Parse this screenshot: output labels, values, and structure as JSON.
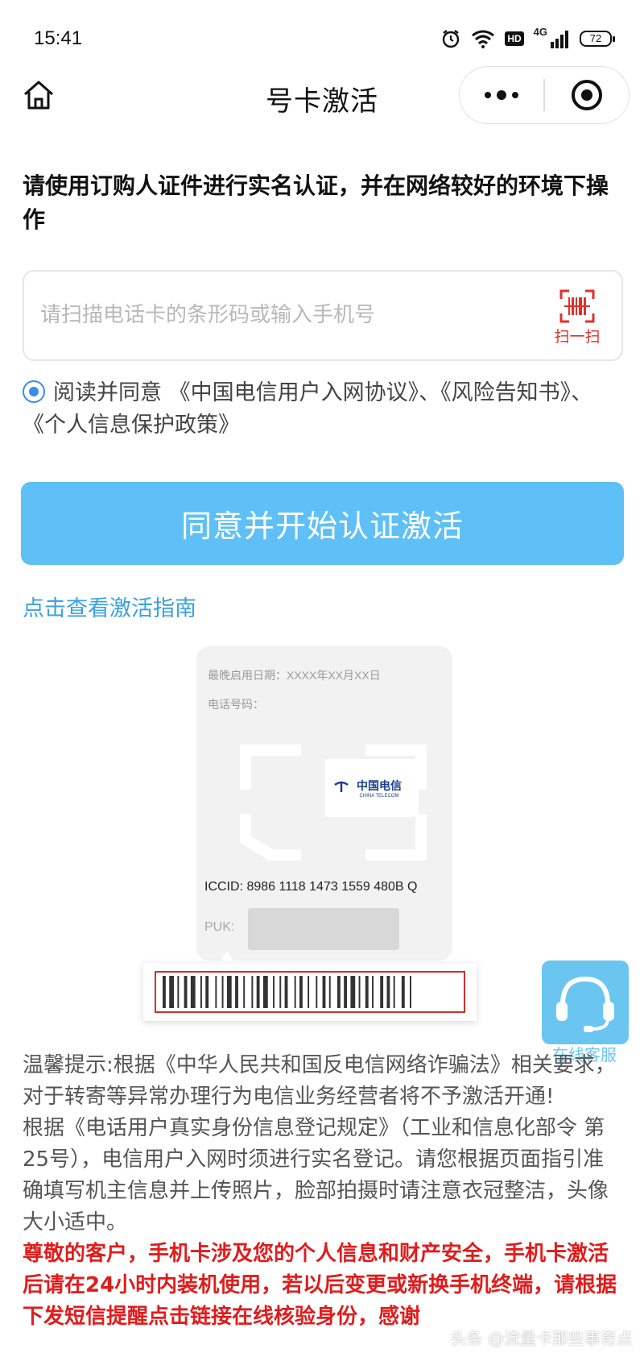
{
  "status_bar": {
    "time": "15:41",
    "network": "4G",
    "hd": "HD",
    "battery": "72"
  },
  "nav": {
    "title": "号卡激活"
  },
  "intro": {
    "text": "请使用订购人证件进行实名认证，并在网络较好的环境下操作"
  },
  "search": {
    "placeholder": "请扫描电话卡的条形码或输入手机号",
    "value": "",
    "scan_label": "扫一扫"
  },
  "agreement": {
    "text": "阅读并同意 《中国电信用户入网协议》、《风险告知书》、《个人信息保护政策》",
    "checked": true
  },
  "primary_button": {
    "label": "同意并开始认证激活"
  },
  "guide_link": {
    "label": "点击查看激活指南"
  },
  "card_illustration": {
    "deadline_line": "最晚启用日期：XXXX年XX月XX日",
    "phone_line": "电话号码：",
    "logo_text": "中国电信",
    "logo_sub": "CHINA TELECOM",
    "iccid": "ICCID:  8986 1118 1473 1559 480B Q",
    "puk_label": "PUK:"
  },
  "customer_service": {
    "label": "在线客服"
  },
  "tips": {
    "p1": "温馨提示:根据《中华人民共和国反电信网络诈骗法》相关要求，对于转寄等异常办理行为电信业务经营者将不予激活开通!",
    "p2": "根据《电话用户真实身份信息登记规定》（工业和信息化部令 第25号），电信用户入网时须进行实名登记。请您根据页面指引准确填写机主信息并上传照片，脸部拍摄时请注意衣冠整洁，头像大小适中。",
    "p3": "尊敬的客户，手机卡涉及您的个人信息和财产安全，手机卡激活后请在24小时内装机使用，若以后变更或新换手机终端，请根据下发短信提醒点击链接在线核验身份，感谢"
  },
  "watermark": "头条 @流量卡那些事奇点",
  "colors": {
    "primary_button": "#5ec0f6",
    "link": "#3aa1e0",
    "warning_red": "#e01c1c",
    "scan_red": "#e0302a",
    "radio_blue": "#3b8de8"
  }
}
